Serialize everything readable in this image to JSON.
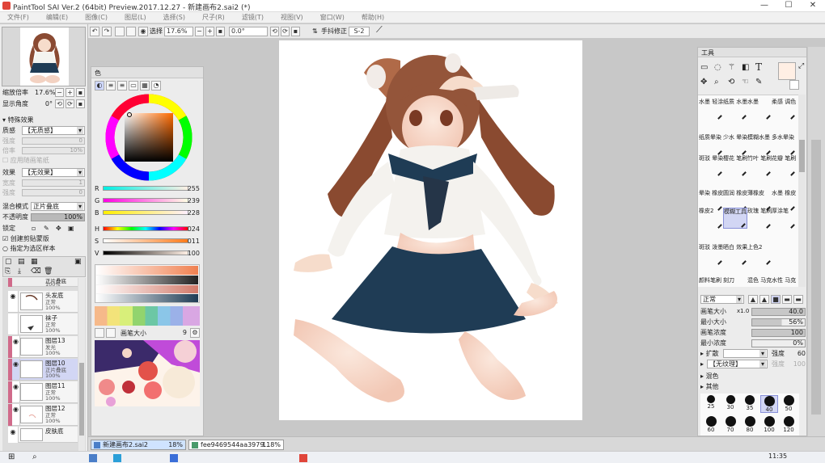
{
  "titlebar": {
    "title": "PaintTool SAI Ver.2 (64bit) Preview.2017.12.27 - 新建画布2.sai2 (*)",
    "minimize": "—",
    "maximize": "☐",
    "close": "✕"
  },
  "menu": [
    "文件(F)",
    "编辑(E)",
    "图像(C)",
    "图层(L)",
    "选择(S)",
    "尺子(R)",
    "滤镜(T)",
    "视图(V)",
    "窗口(W)",
    "帮助(H)"
  ],
  "toolbar": {
    "select_label": "选择",
    "zoom": "17.6%",
    "angle": "0.0°",
    "stabilizer_label": "手抖修正",
    "stabilizer_value": "S-2"
  },
  "navigator": {
    "zoom_label": "缩放倍率",
    "zoom_value": "17.6%",
    "angle_label": "显示角度",
    "angle_value": "0°"
  },
  "layer_props": {
    "effects_header": "特殊效果",
    "texture_label": "质感",
    "texture_value": "【无质感】",
    "scale_label": "强度",
    "scale_value": "0",
    "intensity_label": "倍率",
    "intensity_value": "10%",
    "apply_on_canvas": "应用随画笔纸",
    "effect_label": "效果",
    "effect_value": "【无效果】",
    "width_label": "宽度",
    "width_value": "1",
    "strength_label": "强度",
    "strength_value": "0",
    "blend_label": "混合模式",
    "blend_value": "正片叠底",
    "opacity_label": "不透明度",
    "opacity_value": "100%",
    "lock_label": "锁定",
    "clip_label": "创建剪贴蒙版",
    "ref_label": "指定为选区样本"
  },
  "layers": [
    {
      "name": "正片叠底",
      "mode": "100%",
      "opacity": ""
    },
    {
      "name": "头发底",
      "mode": "正常",
      "opacity": "100%"
    },
    {
      "name": "袜子",
      "mode": "正常",
      "opacity": "100%"
    },
    {
      "name": "图层13",
      "mode": "发光",
      "opacity": "100%"
    },
    {
      "name": "图层10",
      "mode": "正片叠底",
      "opacity": "100%"
    },
    {
      "name": "图层11",
      "mode": "正常",
      "opacity": "100%"
    },
    {
      "name": "图层12",
      "mode": "正常",
      "opacity": "100%"
    },
    {
      "name": "皮肤底",
      "mode": "正常",
      "opacity": ""
    }
  ],
  "color_panel": {
    "header": "色",
    "r": {
      "label": "R",
      "value": "255"
    },
    "g": {
      "label": "G",
      "value": "239"
    },
    "b": {
      "label": "B",
      "value": "228"
    },
    "h": {
      "label": "H",
      "value": "024"
    },
    "s": {
      "label": "S",
      "value": "011"
    },
    "v": {
      "label": "V",
      "value": "100"
    },
    "brush_size_label": "画笔大小",
    "brush_size_value": "9",
    "current_color": "#ffefe4"
  },
  "tool_panel": {
    "header": "工具",
    "brushes": [
      "水墨 轻涂",
      "纸质 水墨",
      "水墨",
      "柔感 调色",
      "纸质晕染",
      "少水 晕染",
      "模糊水墨",
      "多水晕染",
      "斑驳 晕染",
      "樱花 笔刷",
      "竹叶 笔刷",
      "花瓣 笔刷",
      "晕染 橡皮擦",
      "圆润 橡皮擦",
      "薄橡皮",
      "水墨 橡皮",
      "橡皮2",
      "模糊工具",
      "玫瑰 笔刷",
      "厚涂笔",
      "斑驳 泼墨",
      "晒白 效果",
      "上色2",
      "",
      "颜料笔刷",
      "刻刀",
      "混色 马克笔",
      "水性 马克笔"
    ],
    "mode_label": "正常",
    "brush_size_label": "画笔大小",
    "brush_size_mult": "x1.0",
    "brush_size_value": "40.0",
    "min_size_label": "最小大小",
    "min_size_value": "56%",
    "density_label": "画笔浓度",
    "density_value": "100",
    "min_density_label": "最小浓度",
    "min_density_value": "0%",
    "spread_label": "扩散",
    "spread_right": "强度",
    "spread_value": "60",
    "texture_label": "【无纹理】",
    "texture_right": "强度",
    "texture_value": "100",
    "mix_label": "混色",
    "other_label": "其他",
    "sizes": [
      "25",
      "30",
      "35",
      "40",
      "50",
      "60",
      "70",
      "80",
      "100",
      "120"
    ]
  },
  "status": {
    "tab1_name": "新建画布2.sai2",
    "tab1_zoom": "18%",
    "tab2_name": "fee9469544aa3979...",
    "tab2_zoom": "118%"
  },
  "taskbar": {
    "time": "11:35"
  }
}
